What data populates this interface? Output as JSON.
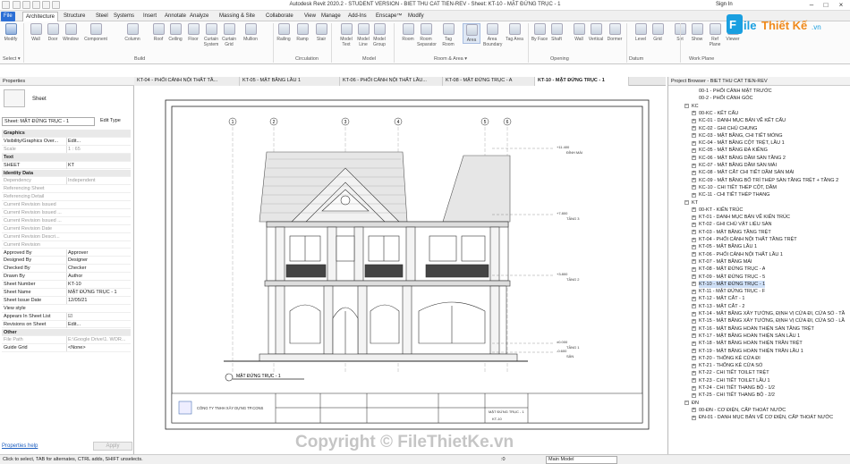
{
  "titlebar": {
    "title": "Autodesk Revit 2020.2 - STUDENT VERSION - BIET THU CAT TIEN-REV - Sheet: KT-10 - MẶT ĐỨNG TRỤC - 1",
    "sign_in": "Sign In"
  },
  "ribbon_tabs": [
    "File",
    "Architecture",
    "Structure",
    "Steel",
    "Systems",
    "Insert",
    "Annotate",
    "Analyze",
    "Massing & Site",
    "Collaborate",
    "View",
    "Manage",
    "Add-Ins",
    "Enscape™",
    "Modify"
  ],
  "tools": [
    {
      "label": "Modify"
    },
    {
      "label": "Wall"
    },
    {
      "label": "Door"
    },
    {
      "label": "Window"
    },
    {
      "label": "Component"
    },
    {
      "label": "Column"
    },
    {
      "label": "Roof"
    },
    {
      "label": "Ceiling"
    },
    {
      "label": "Floor"
    },
    {
      "label": "Curtain System"
    },
    {
      "label": "Curtain Grid"
    },
    {
      "label": "Mullion"
    },
    {
      "label": "Railing"
    },
    {
      "label": "Ramp"
    },
    {
      "label": "Stair"
    },
    {
      "label": "Model Text"
    },
    {
      "label": "Model Line"
    },
    {
      "label": "Model Group"
    },
    {
      "label": "Room"
    },
    {
      "label": "Room Separator"
    },
    {
      "label": "Tag Room"
    },
    {
      "label": "Area"
    },
    {
      "label": "Area Boundary"
    },
    {
      "label": "Tag Area"
    },
    {
      "label": "By Face"
    },
    {
      "label": "Shaft"
    },
    {
      "label": "Wall"
    },
    {
      "label": "Vertical"
    },
    {
      "label": "Dormer"
    },
    {
      "label": "Level"
    },
    {
      "label": "Grid"
    },
    {
      "label": "Set"
    },
    {
      "label": "Show"
    },
    {
      "label": "Ref Plane"
    },
    {
      "label": "Viewer"
    }
  ],
  "panels": [
    "Select ▾",
    "Build",
    "Circulation",
    "Model",
    "Room & Area ▾",
    "Opening",
    "Datum",
    "Work Plane"
  ],
  "view_tabs": [
    "KT-04 - PHỐI CẢNH NỘI THẤT TẦ...",
    "KT-05 - MẶT BẰNG LẦU 1",
    "KT-06 - PHỐI CẢNH NỘI THẤT LẦU...",
    "KT-08 - MẶT ĐỨNG TRỤC - A",
    "KT-10 - MẶT ĐỨNG TRỤC - 1"
  ],
  "properties": {
    "title": "Properties",
    "type_name": "Sheet",
    "selector": "Sheet: MẶT ĐỨNG TRỤC - 1",
    "edit_type": "Edit Type",
    "rows": [
      {
        "k": "Graphics",
        "v": "",
        "group": true
      },
      {
        "k": "Visibility/Graphics Over...",
        "v": "Edit..."
      },
      {
        "k": "Scale",
        "v": "1 : 65",
        "grey": true
      },
      {
        "k": "Text",
        "v": "",
        "group": true
      },
      {
        "k": "SHEET",
        "v": "KT"
      },
      {
        "k": "Identity Data",
        "v": "",
        "group": true
      },
      {
        "k": "Dependency",
        "v": "Independent",
        "grey": true
      },
      {
        "k": "Referencing Sheet",
        "v": "",
        "grey": true
      },
      {
        "k": "Referencing Detail",
        "v": "",
        "grey": true
      },
      {
        "k": "Current Revision Issued",
        "v": "",
        "grey": true
      },
      {
        "k": "Current Revision Issued ...",
        "v": "",
        "grey": true
      },
      {
        "k": "Current Revision Issued ...",
        "v": "",
        "grey": true
      },
      {
        "k": "Current Revision Date",
        "v": "",
        "grey": true
      },
      {
        "k": "Current Revision Descri...",
        "v": "",
        "grey": true
      },
      {
        "k": "Current Revision",
        "v": "",
        "grey": true
      },
      {
        "k": "Approved By",
        "v": "Approver"
      },
      {
        "k": "Designed By",
        "v": "Designer"
      },
      {
        "k": "Checked By",
        "v": "Checker"
      },
      {
        "k": "Drawn By",
        "v": "Author"
      },
      {
        "k": "Sheet Number",
        "v": "KT-10"
      },
      {
        "k": "Sheet Name",
        "v": "MẶT ĐỨNG TRỤC - 1"
      },
      {
        "k": "Sheet Issue Date",
        "v": "12/05/21"
      },
      {
        "k": "View style",
        "v": ""
      },
      {
        "k": "Appears In Sheet List",
        "v": "☑"
      },
      {
        "k": "Revisions on Sheet",
        "v": "Edit..."
      },
      {
        "k": "Other",
        "v": "",
        "group": true
      },
      {
        "k": "File Path",
        "v": "E:\\Google Drive\\1. WOR...",
        "grey": true
      },
      {
        "k": "Guide Grid",
        "v": "<None>"
      }
    ],
    "help": "Properties help",
    "apply": "Apply"
  },
  "drawing": {
    "elevation_tags": [
      {
        "text": "+11.400",
        "label": "ĐỈNH MÁI"
      },
      {
        "text": "+7.800",
        "label": "TẦNG 3"
      },
      {
        "text": "+3.800",
        "label": "TẦNG 2"
      },
      {
        "text": "±0.000",
        "label": "TẦNG 1"
      },
      {
        "text": "-0.600",
        "label": "SÂN"
      }
    ],
    "grid_labels": [
      "1",
      "2",
      "3",
      "4",
      "5",
      "6"
    ],
    "title_caption": "MẶT ĐỨNG TRỤC - 1",
    "company": "CÔNG TY TNHH XÂY DỰNG TP.CONS",
    "sheet_name": "MẶT ĐỨNG TRỤC - 1",
    "sheet_no": "KT-10"
  },
  "browser": {
    "title": "Project Browser - BIET THU CAT TIEN-REV",
    "items": [
      {
        "t": "00-1 - PHỐI CẢNH MẶT TRƯỚC",
        "lvl": 2
      },
      {
        "t": "00-2 - PHỐI CẢNH GÓC",
        "lvl": 2
      },
      {
        "t": "KC",
        "lvl": 1,
        "tog": "−"
      },
      {
        "t": "00-KC - KẾT CẤU",
        "lvl": 2,
        "tog": "+"
      },
      {
        "t": "KC-01 - DANH MỤC BẢN VẼ KẾT CẤU",
        "lvl": 2,
        "tog": "+"
      },
      {
        "t": "KC-02 - GHI CHÚ CHUNG",
        "lvl": 2,
        "tog": "+"
      },
      {
        "t": "KC-03 - MẶT BẰNG, CHI TIẾT MÓNG",
        "lvl": 2,
        "tog": "+"
      },
      {
        "t": "KC-04 - MẶT BẰNG CỘT TRỆT, LẦU 1",
        "lvl": 2,
        "tog": "+"
      },
      {
        "t": "KC-05 - MẶT BẰNG ĐÀ KIỀNG",
        "lvl": 2,
        "tog": "+"
      },
      {
        "t": "KC-06 - MẶT BẰNG DẦM SÀN TẦNG 2",
        "lvl": 2,
        "tog": "+"
      },
      {
        "t": "KC-07 - MẶT BẰNG DẦM SÀN MÁI",
        "lvl": 2,
        "tog": "+"
      },
      {
        "t": "KC-08 - MẶT CẮT CHI TIẾT DẦM SÀN MÁI",
        "lvl": 2,
        "tog": "+"
      },
      {
        "t": "KC-09 - MẶT BẰNG BỐ TRÍ THÉP SÀN TẦNG TRỆT + TẦNG 2",
        "lvl": 2,
        "tog": "+"
      },
      {
        "t": "KC-10 - CHI TIẾT THÉP CỘT, DẦM",
        "lvl": 2,
        "tog": "+"
      },
      {
        "t": "KC-11 - CHI TIẾT THÉP THANG",
        "lvl": 2,
        "tog": "+"
      },
      {
        "t": "KT",
        "lvl": 1,
        "tog": "−"
      },
      {
        "t": "00-KT - KIẾN TRÚC",
        "lvl": 2,
        "tog": "+"
      },
      {
        "t": "KT-01 - DANH MỤC BẢN VẼ KIẾN TRÚC",
        "lvl": 2,
        "tog": "+"
      },
      {
        "t": "KT-02 - GHI CHÚ VẬT LIỆU SÀN",
        "lvl": 2,
        "tog": "+"
      },
      {
        "t": "KT-03 - MẶT BẰNG TẦNG TRỆT",
        "lvl": 2,
        "tog": "+"
      },
      {
        "t": "KT-04 - PHỐI CẢNH NỘI THẤT TẦNG TRỆT",
        "lvl": 2,
        "tog": "+"
      },
      {
        "t": "KT-05 - MẶT BẰNG LẦU 1",
        "lvl": 2,
        "tog": "+"
      },
      {
        "t": "KT-06 - PHỐI CẢNH NỘI THẤT LẦU 1",
        "lvl": 2,
        "tog": "+"
      },
      {
        "t": "KT-07 - MẶT BẰNG MÁI",
        "lvl": 2,
        "tog": "+"
      },
      {
        "t": "KT-08 - MẶT ĐỨNG TRỤC - A",
        "lvl": 2,
        "tog": "+"
      },
      {
        "t": "KT-09 - MẶT ĐỨNG TRỤC - 5",
        "lvl": 2,
        "tog": "+"
      },
      {
        "t": "KT-10 - MẶT ĐỨNG TRỤC - 1",
        "lvl": 2,
        "tog": "+",
        "sel": true
      },
      {
        "t": "KT-11 - MẶT ĐỨNG TRỤC - F",
        "lvl": 2,
        "tog": "+"
      },
      {
        "t": "KT-12 - MẶT CẮT - 1",
        "lvl": 2,
        "tog": "+"
      },
      {
        "t": "KT-13 - MẶT CẮT - 2",
        "lvl": 2,
        "tog": "+"
      },
      {
        "t": "KT-14 - MẶT BẰNG XÂY TƯỜNG, ĐỊNH VỊ CỬA ĐI, CỬA SỔ - TẦ",
        "lvl": 2,
        "tog": "+"
      },
      {
        "t": "KT-15 - MẶT BẰNG XÂY TƯỜNG, ĐỊNH VỊ CỬA ĐI, CỬA SỔ - LẦ",
        "lvl": 2,
        "tog": "+"
      },
      {
        "t": "KT-16 - MẶT BẰNG HOÀN THIỆN SÀN TẦNG TRỆT",
        "lvl": 2,
        "tog": "+"
      },
      {
        "t": "KT-17 - MẶT BẰNG HOÀN THIỆN SÀN LẦU 1",
        "lvl": 2,
        "tog": "+"
      },
      {
        "t": "KT-18 - MẶT BẰNG HOÀN THIỆN TRẦN TRỆT",
        "lvl": 2,
        "tog": "+"
      },
      {
        "t": "KT-19 - MẶT BẰNG HOÀN THIỆN TRẦN LẦU 1",
        "lvl": 2,
        "tog": "+"
      },
      {
        "t": "KT-20 - THỐNG KÊ CỬA ĐI",
        "lvl": 2,
        "tog": "+"
      },
      {
        "t": "KT-21 - THỐNG KÊ CỬA SỔ",
        "lvl": 2,
        "tog": "+"
      },
      {
        "t": "KT-22 - CHI TIẾT TOILET TRỆT",
        "lvl": 2,
        "tog": "+"
      },
      {
        "t": "KT-23 - CHI TIẾT TOILET LẦU 1",
        "lvl": 2,
        "tog": "+"
      },
      {
        "t": "KT-24 - CHI TIẾT THANG BỘ - 1/2",
        "lvl": 2,
        "tog": "+"
      },
      {
        "t": "KT-25 - CHI TIẾT THANG BỘ - 2/2",
        "lvl": 2,
        "tog": "+"
      },
      {
        "t": "ĐN",
        "lvl": 1,
        "tog": "−"
      },
      {
        "t": "00-ĐN - CƠ ĐIỆN, CẤP THOÁT NƯỚC",
        "lvl": 2,
        "tog": "+"
      },
      {
        "t": "ĐN-01 - DANH MỤC BẢN VẼ CƠ ĐIỆN, CẤP THOÁT NƯỚC",
        "lvl": 2,
        "tog": "+"
      }
    ]
  },
  "status": {
    "hint": "Click to select, TAB for alternates, CTRL adds, SHIFT unselects.",
    "model": "Main Model",
    "coord": ":0"
  },
  "watermark": "Copyright © FileThietKe.vn",
  "logo": {
    "a": "File",
    "b": "Thiết Kế",
    ".vn": ".vn"
  }
}
